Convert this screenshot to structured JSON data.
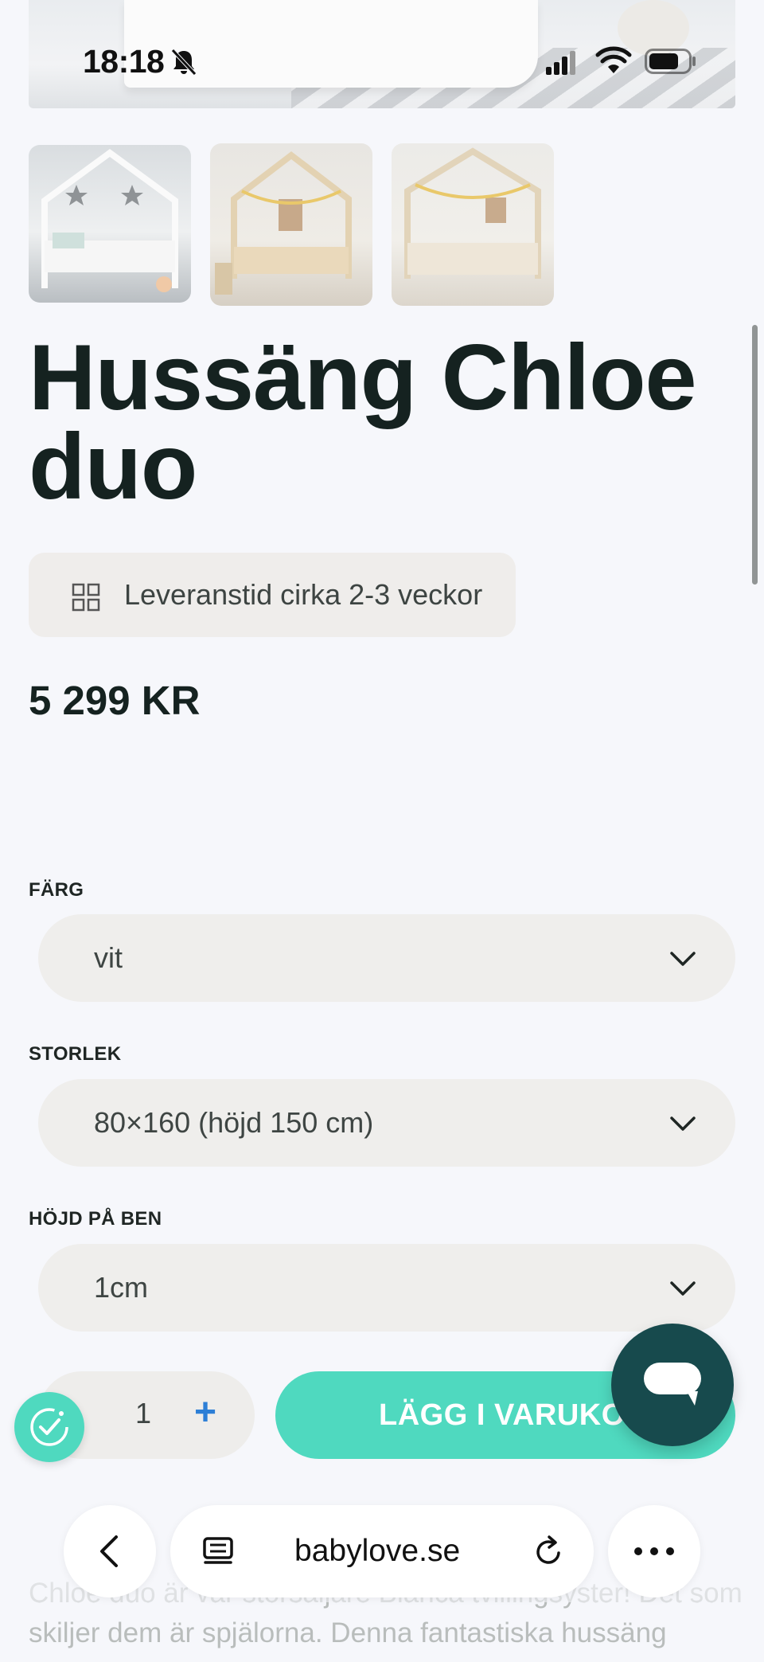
{
  "status_bar": {
    "time": "18:18"
  },
  "product": {
    "title": "Hussäng Chloe duo",
    "delivery": "Leveranstid cirka 2-3 veckor",
    "price": "5 299 KR"
  },
  "options": {
    "color": {
      "label": "FÄRG",
      "value": "vit"
    },
    "size": {
      "label": "STORLEK",
      "value": "80×160 (höjd 150 cm)"
    },
    "leg_height": {
      "label": "HÖJD PÅ BEN",
      "value": "1cm"
    }
  },
  "purchase": {
    "quantity": "1",
    "minus": "-",
    "plus": "+",
    "add_to_cart": "LÄGG I VARUKORG"
  },
  "description": "Chloe duo är vår storsäljare Bianca tvillingsyster! Det som skiljer dem är spjälorna. Denna fantastiska hussäng",
  "browser": {
    "url": "babylove.se"
  },
  "icons": {
    "notification_muted": "bell-slash-icon",
    "delivery": "grid-icon",
    "chat": "chat-bubble-icon",
    "consent": "cookie-check-icon"
  },
  "colors": {
    "accent": "#4fd9bf",
    "chat": "#174a4d",
    "quantity_controls": "#2d7fd6"
  }
}
